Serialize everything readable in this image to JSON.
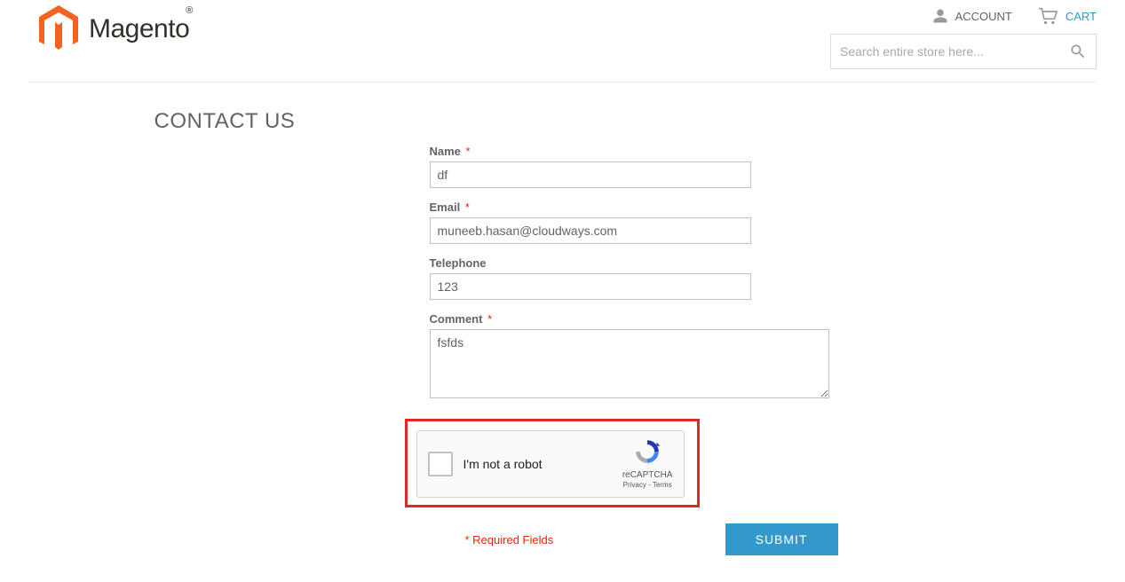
{
  "header": {
    "account_label": "ACCOUNT",
    "cart_label": "CART",
    "search_placeholder": "Search entire store here...",
    "logo_text": "Magento",
    "logo_trademark": "®"
  },
  "page": {
    "title": "CONTACT US"
  },
  "form": {
    "name": {
      "label": "Name",
      "value": "df",
      "required": true
    },
    "email": {
      "label": "Email",
      "value": "muneeb.hasan@cloudways.com",
      "required": true
    },
    "telephone": {
      "label": "Telephone",
      "value": "123",
      "required": false
    },
    "comment": {
      "label": "Comment",
      "value": "fsfds",
      "required": true
    },
    "required_note": "* Required Fields",
    "submit_label": "SUBMIT",
    "required_marker": "*"
  },
  "recaptcha": {
    "label": "I'm not a robot",
    "brand": "reCAPTCHA",
    "privacy": "Privacy",
    "terms": "Terms",
    "separator": " - "
  }
}
